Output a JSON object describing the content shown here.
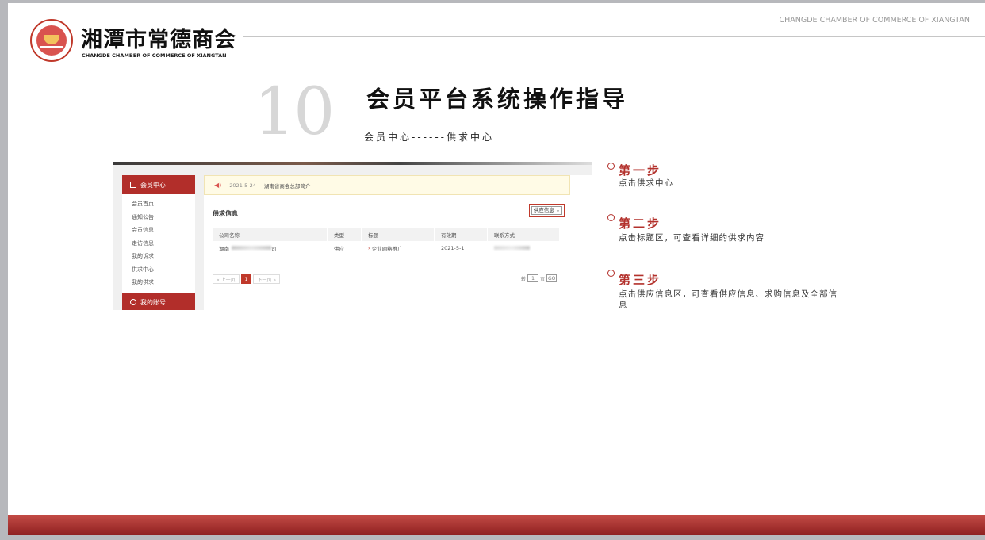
{
  "header": {
    "brand_cn": "湘潭市常德商会",
    "brand_en": "CHANGDE CHAMBER OF COMMERCE OF XIANGTAN",
    "tagline": "CHANGDE CHAMBER OF COMMERCE OF XIANGTAN"
  },
  "slide": {
    "number": "10",
    "title": "会员平台系统操作指导",
    "subtitle": "会员中心------供求中心"
  },
  "screenshot": {
    "sidebar": {
      "header": "会员中心",
      "items": [
        "会员首页",
        "通知公告",
        "会员信息",
        "走访信息",
        "我的诉求",
        "供求中心",
        "我的供求"
      ],
      "active_index": 5,
      "header2": "我的账号"
    },
    "notice": {
      "date": "2021-5-24",
      "message": "湖南省商会总部简介"
    },
    "section_title": "供求信息",
    "dropdown_value": "供应信息",
    "table": {
      "headers": [
        "公司名称",
        "类型",
        "标题",
        "有效期",
        "联系方式"
      ],
      "row": {
        "company_prefix": "湖南",
        "company_suffix": "司",
        "type": "供应",
        "title": "企业网络推广",
        "expire": "2021-5-1"
      }
    },
    "pager": {
      "prev": "« 上一页",
      "current": "1",
      "next": "下一页 »",
      "jump_prefix": "转",
      "jump_value": "1",
      "jump_suffix": "页",
      "go": "GO"
    }
  },
  "steps": [
    {
      "title": "第一步",
      "desc": "点击供求中心"
    },
    {
      "title": "第二步",
      "desc": "点击标题区，可查看详细的供求内容"
    },
    {
      "title": "第三步",
      "desc": "点击供应信息区，可查看供应信息、求购信息及全部信息"
    }
  ],
  "colors": {
    "accent": "#b3312c",
    "footer": "#8e2020"
  }
}
